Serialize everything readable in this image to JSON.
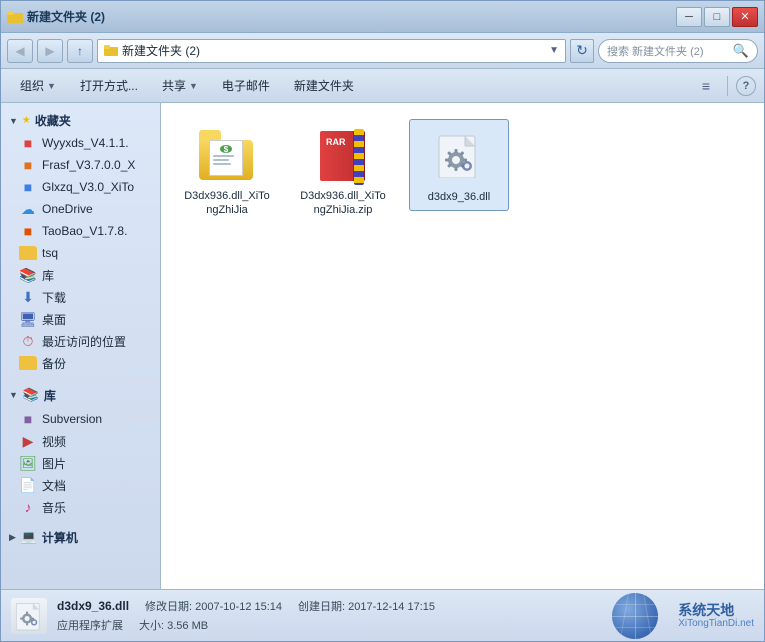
{
  "window": {
    "title": "新建文件夹 (2)",
    "title_display": "新建文件夹 (2)"
  },
  "titlebar": {
    "minimize": "─",
    "maximize": "□",
    "close": "✕"
  },
  "addressbar": {
    "path": "新建文件夹 (2)",
    "search_placeholder": "搜索 新建文件夹 (2)",
    "back_title": "后退",
    "forward_title": "前进",
    "up_title": "上级",
    "refresh_title": "刷新"
  },
  "toolbar": {
    "organize": "组织",
    "open_with": "打开方式...",
    "share": "共享",
    "email": "电子邮件",
    "new_folder": "新建文件夹",
    "views_icon": "≡",
    "help_icon": "?"
  },
  "sidebar": {
    "favorites_label": "收藏夹",
    "items_favorites": [
      {
        "label": "Wyyxds_V4.1.1.",
        "icon": "wyy"
      },
      {
        "label": "Frasf_V3.7.0.0_X",
        "icon": "frasf"
      },
      {
        "label": "Glxzq_V3.0_XiTo",
        "icon": "glx"
      },
      {
        "label": "OneDrive",
        "icon": "onedrive"
      },
      {
        "label": "TaoBao_V1.7.8.",
        "icon": "taobao"
      },
      {
        "label": "tsq",
        "icon": "folder"
      },
      {
        "label": "库",
        "icon": "ku"
      },
      {
        "label": "下载",
        "icon": "download"
      },
      {
        "label": "桌面",
        "icon": "desktop"
      },
      {
        "label": "最近访问的位置",
        "icon": "recent"
      },
      {
        "label": "备份",
        "icon": "backup"
      }
    ],
    "lib_label": "库",
    "items_library": [
      {
        "label": "Subversion",
        "icon": "subversion"
      },
      {
        "label": "视频",
        "icon": "video"
      },
      {
        "label": "图片",
        "icon": "image"
      },
      {
        "label": "文档",
        "icon": "doc"
      },
      {
        "label": "音乐",
        "icon": "music"
      }
    ],
    "computer_label": "计算机"
  },
  "files": [
    {
      "name": "D3dx936.dll_XiTongZhiJia",
      "type": "folder",
      "id": "file-folder1"
    },
    {
      "name": "D3dx936.dll_XiTongZhiJia.zip",
      "type": "zip",
      "id": "file-zip1"
    },
    {
      "name": "d3dx9_36.dll",
      "type": "dll",
      "id": "file-dll1",
      "selected": true
    }
  ],
  "statusbar": {
    "filename": "d3dx9_36.dll",
    "modify_label": "修改日期:",
    "modify_date": "2007-10-12 15:14",
    "create_label": "创建日期:",
    "create_date": "2017-12-14 17:15",
    "type_label": "应用程序扩展",
    "size_label": "大小:",
    "size_value": "3.56 MB",
    "watermark_line1": "系统天地",
    "watermark_line2": "XiTongTianDi.net"
  }
}
